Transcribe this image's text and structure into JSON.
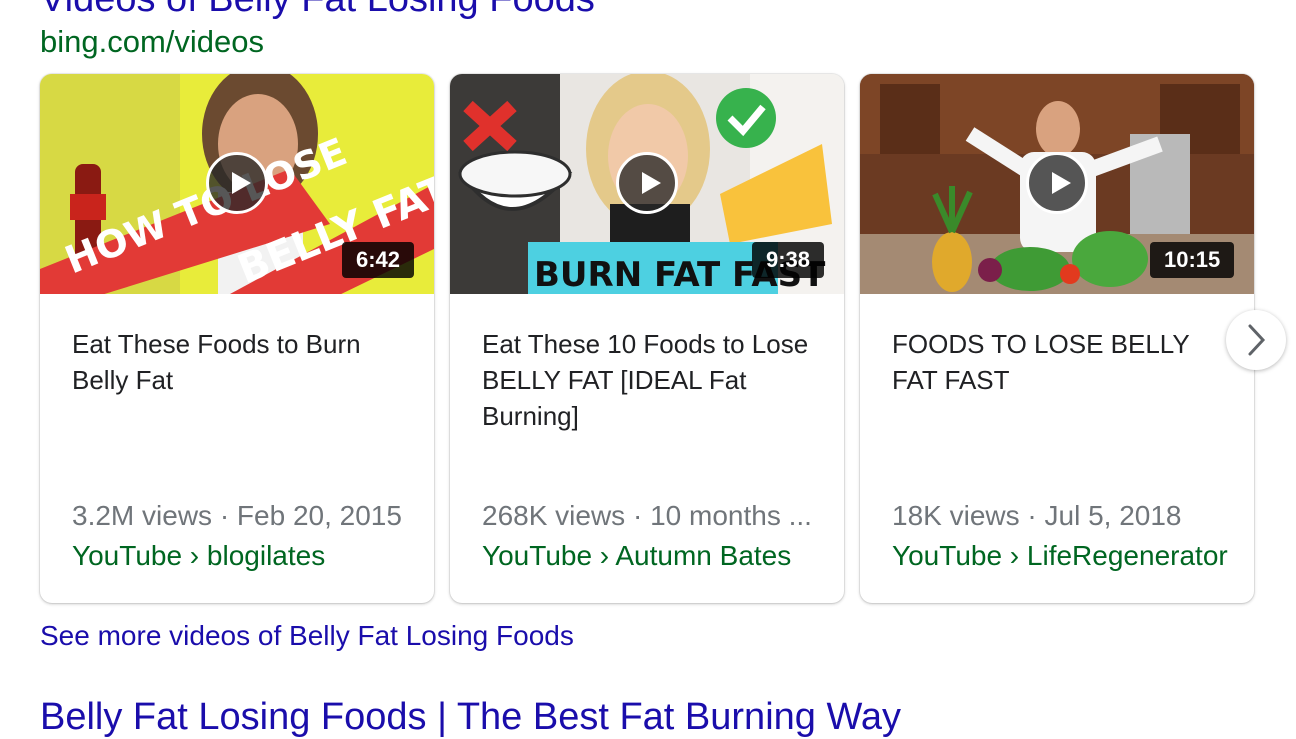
{
  "section": {
    "title": "Videos of Belly Fat Losing Foods",
    "source": "bing.com/videos"
  },
  "videos": [
    {
      "duration": "6:42",
      "title": "Eat These Foods to Burn Belly Fat",
      "views": "3.2M views",
      "date": "Feb 20, 2015",
      "meta": "3.2M views · Feb 20, 2015",
      "channel": "YouTube › blogilates",
      "thumb_text": [
        "HOW TO LOSE",
        "BELLY FAT"
      ],
      "thumb_bg": "#e8ec3a"
    },
    {
      "duration": "9:38",
      "title": "Eat These 10 Foods to Lose BELLY FAT [IDEAL Fat Burning]",
      "views": "268K views",
      "date": "10 months ...",
      "meta": "268K views · 10 months ...",
      "channel": "YouTube › Autumn Bates",
      "thumb_text": [
        "BURN FAT FAST"
      ],
      "thumb_bg": "#e9e6e2"
    },
    {
      "duration": "10:15",
      "title": "FOODS TO LOSE BELLY FAT FAST",
      "views": "18K views",
      "date": "Jul 5, 2018",
      "meta": "18K views · Jul 5, 2018",
      "channel": "YouTube › LifeRegenerator",
      "thumb_text": [],
      "thumb_bg": "#6b3a22"
    }
  ],
  "see_more": "See more videos of Belly Fat Losing Foods",
  "next_result_title": "Belly Fat Losing Foods | The Best Fat Burning Way",
  "colors": {
    "link": "#1a0dab",
    "url_green": "#006621",
    "meta_gray": "#70757a",
    "title_text": "#202124"
  }
}
